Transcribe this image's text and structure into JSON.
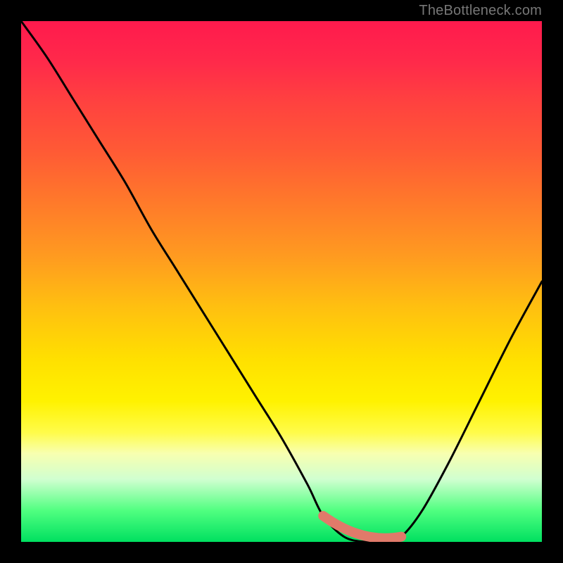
{
  "watermark": "TheBottleneck.com",
  "colors": {
    "background": "#000000",
    "gradient_top": "#ff1a4d",
    "gradient_mid": "#ffe000",
    "gradient_bottom": "#00e060",
    "curve": "#000000",
    "marker": "#e07a6a"
  },
  "chart_data": {
    "type": "line",
    "title": "",
    "xlabel": "",
    "ylabel": "",
    "xlim": [
      0,
      1
    ],
    "ylim": [
      0,
      1
    ],
    "series": [
      {
        "name": "curve",
        "x": [
          0.0,
          0.05,
          0.1,
          0.15,
          0.2,
          0.25,
          0.3,
          0.35,
          0.4,
          0.45,
          0.5,
          0.55,
          0.58,
          0.62,
          0.66,
          0.7,
          0.73,
          0.77,
          0.82,
          0.88,
          0.94,
          1.0
        ],
        "values": [
          1.0,
          0.93,
          0.85,
          0.77,
          0.69,
          0.6,
          0.52,
          0.44,
          0.36,
          0.28,
          0.2,
          0.11,
          0.05,
          0.01,
          0.0,
          0.0,
          0.01,
          0.06,
          0.15,
          0.27,
          0.39,
          0.5
        ]
      }
    ],
    "marker_segment": {
      "x_start": 0.58,
      "x_end": 0.73,
      "y": 0.01
    }
  }
}
